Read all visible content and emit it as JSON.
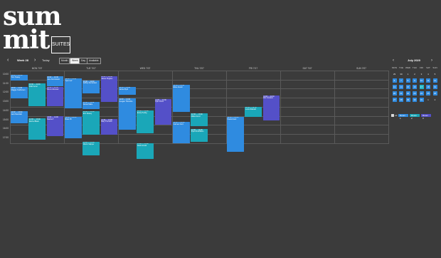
{
  "logo": {
    "line1": "sum",
    "line2": "mit",
    "badge": "SUITES"
  },
  "toolbar": {
    "week": "Week 28",
    "today": "Today",
    "views": [
      "Month",
      "Week",
      "Day",
      "Available"
    ],
    "active_view": "Week"
  },
  "days": [
    "MON 7/07",
    "TUE 7/07",
    "WED 7/07",
    "THU 7/07",
    "FRI 7/17",
    "SAT 7/07",
    "SUN 7/07"
  ],
  "times": [
    "10:00",
    "11:00",
    "12:00",
    "13:00",
    "14:00",
    "15:00",
    "16:00",
    "17:00"
  ],
  "colors": {
    "blue": "#2f8be0",
    "teal": "#1aa7b8",
    "purple": "#5450c8",
    "bg": "#3b3b3b"
  },
  "events": [
    {
      "day": 0,
      "col": 0,
      "start": 9.9,
      "end": 10.55,
      "color": "blue",
      "time": "10:00 — 10:30",
      "title": "Tom Healey"
    },
    {
      "day": 0,
      "col": 0,
      "start": 11.3,
      "end": 12.5,
      "color": "blue",
      "time": "10:30 — 11:00",
      "title": "Maggie Scaffersen"
    },
    {
      "day": 0,
      "col": 0,
      "start": 13.95,
      "end": 15.3,
      "color": "blue",
      "time": "12:00 — 13:00",
      "title": "Jack Pastolski"
    },
    {
      "day": 0,
      "col": 1,
      "start": 10.9,
      "end": 13.4,
      "color": "teal",
      "time": "10:30 — 11:30",
      "title": "Patti Ferrer"
    },
    {
      "day": 0,
      "col": 1,
      "start": 14.75,
      "end": 17.1,
      "color": "teal",
      "time": "12:00 — 13:00",
      "title": "Rachel Black"
    },
    {
      "day": 0,
      "col": 2,
      "start": 10.1,
      "end": 11.15,
      "color": "blue",
      "time": "10:00 — 10:30",
      "title": "Jane Dermission"
    },
    {
      "day": 0,
      "col": 2,
      "start": 11.25,
      "end": 13.4,
      "color": "purple",
      "time": "10:30 — 11:00",
      "title": "Bruno Attonsier"
    },
    {
      "day": 0,
      "col": 2,
      "start": 14.5,
      "end": 16.7,
      "color": "purple",
      "time": "13:00 — 14:00",
      "title": "Marina T."
    },
    {
      "day": 1,
      "col": 0,
      "start": 10.3,
      "end": 13.6,
      "color": "blue",
      "time": "10:00 — 11:00",
      "title": "Tyler Lief"
    },
    {
      "day": 1,
      "col": 0,
      "start": 14.55,
      "end": 16.9,
      "color": "blue",
      "time": "12:00 — 13:00",
      "title": "Brian Pit"
    },
    {
      "day": 1,
      "col": 1,
      "start": 10.55,
      "end": 11.95,
      "color": "blue",
      "time": "10:30 — 11:00",
      "title": "Jeffrey Fernandez"
    },
    {
      "day": 1,
      "col": 1,
      "start": 12.9,
      "end": 13.7,
      "color": "blue",
      "time": "11:00 — 11:30",
      "title": "Daniel Maite"
    },
    {
      "day": 1,
      "col": 1,
      "start": 13.9,
      "end": 16.5,
      "color": "teal",
      "time": "12:00 — 13:00",
      "title": "Erin Dewey"
    },
    {
      "day": 1,
      "col": 1,
      "start": 17.3,
      "end": 18.8,
      "color": "teal",
      "time": "14:00 — 15:00",
      "title": "Martin Skipper"
    },
    {
      "day": 1,
      "col": 2,
      "start": 10.05,
      "end": 12.95,
      "color": "purple",
      "time": "10:00 — 10:30",
      "title": "James Hughes"
    },
    {
      "day": 1,
      "col": 2,
      "start": 14.8,
      "end": 16.5,
      "color": "purple",
      "time": "12:30 — 13:00",
      "title": "Mary Tremaris"
    },
    {
      "day": 2,
      "col": 0,
      "start": 11.25,
      "end": 12.1,
      "color": "blue",
      "time": "10:30 — 11:00",
      "title": "Janice Byrd"
    },
    {
      "day": 2,
      "col": 0,
      "start": 12.55,
      "end": 15.95,
      "color": "blue",
      "time": "11:00 — 12:00",
      "title": "Keegan Thimothe"
    },
    {
      "day": 2,
      "col": 1,
      "start": 13.85,
      "end": 16.4,
      "color": "teal",
      "time": "12:00 — 13:00",
      "title": "Emily Hodrig"
    },
    {
      "day": 2,
      "col": 1,
      "start": 17.45,
      "end": 19.2,
      "color": "teal",
      "time": "14:00 — 15:00",
      "title": "Noah Arnold"
    },
    {
      "day": 2,
      "col": 2,
      "start": 12.6,
      "end": 15.4,
      "color": "purple",
      "time": "11:00 — 12:00",
      "title": "Kyle Jones"
    },
    {
      "day": 3,
      "col": 0,
      "start": 11.0,
      "end": 14.0,
      "color": "blue",
      "time": "10:30 — 11:00",
      "title": "Elisa Jovetic"
    },
    {
      "day": 3,
      "col": 0,
      "start": 15.1,
      "end": 17.5,
      "color": "blue",
      "time": "13:00 — 14:00",
      "title": "Carmen Ford"
    },
    {
      "day": 3,
      "col": 1,
      "start": 14.2,
      "end": 15.6,
      "color": "teal",
      "time": "12:30 — 13:00",
      "title": "Mabel Arnol"
    },
    {
      "day": 3,
      "col": 1,
      "start": 15.9,
      "end": 17.3,
      "color": "teal",
      "time": "13:30 — 14:00",
      "title": "Ryan Fredrikson"
    },
    {
      "day": 4,
      "col": 0,
      "start": 14.55,
      "end": 18.4,
      "color": "blue",
      "time": "12:30 — 13:00",
      "title": "Paula Grant"
    },
    {
      "day": 4,
      "col": 1,
      "start": 13.45,
      "end": 14.55,
      "color": "teal",
      "time": "12:00 — 12:30",
      "title": "Lucia Waddell"
    },
    {
      "day": 4,
      "col": 2,
      "start": 12.2,
      "end": 15.0,
      "color": "purple",
      "time": "11:00 — 11:30",
      "title": "Eric Coulson"
    }
  ],
  "mini": {
    "title": "July 2020",
    "dow": [
      "MON",
      "TUE",
      "WED",
      "THU",
      "FRI",
      "SAT",
      "SUN"
    ],
    "weeks": [
      [
        "29",
        "30",
        "1",
        "2",
        "3",
        "4",
        "5"
      ],
      [
        "6",
        "7",
        "8",
        "9",
        "10",
        "11",
        "12"
      ],
      [
        "13",
        "14",
        "15",
        "16",
        "17",
        "18",
        "19"
      ],
      [
        "20",
        "21",
        "22",
        "23",
        "24",
        "25",
        "26"
      ],
      [
        "27",
        "28",
        "29",
        "30",
        "31",
        "1",
        "2"
      ]
    ],
    "shift": 1,
    "today": "17"
  },
  "legend": {
    "all": "All",
    "rooms": [
      {
        "name": "Room 1",
        "color": "#2f8be0"
      },
      {
        "name": "Room 2",
        "color": "#1aa7b8"
      },
      {
        "name": "Room 3",
        "color": "#5450c8"
      }
    ]
  }
}
